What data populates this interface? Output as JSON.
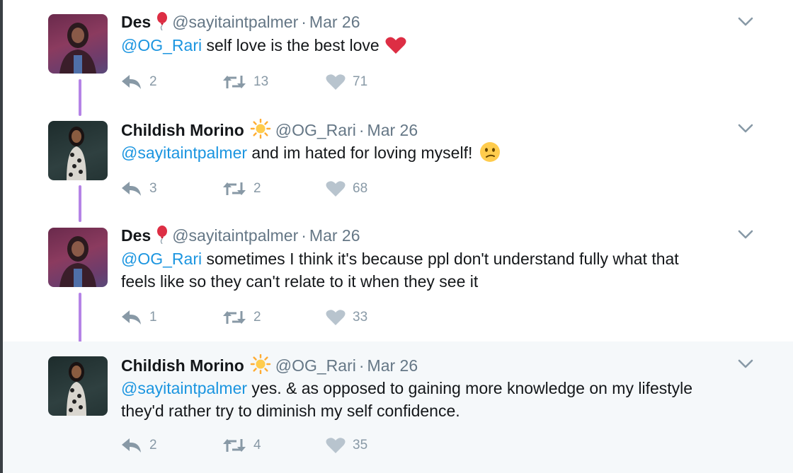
{
  "tweets": [
    {
      "name": "Des",
      "name_emoji": "balloon-icon",
      "handle": "@sayitaintpalmer",
      "separator": "·",
      "date": "Mar 26",
      "mention": "@OG_Rari",
      "line1": " self love is the best love",
      "line2": "",
      "trailing_emoji": "heart-emoji-icon",
      "replies": "2",
      "retweets": "13",
      "likes": "71"
    },
    {
      "name": "Childish Morino",
      "name_emoji": "sun-icon",
      "handle": "@OG_Rari",
      "separator": "·",
      "date": "Mar 26",
      "mention": "@sayitaintpalmer",
      "line1": " and im hated for loving myself!",
      "line2": "",
      "trailing_emoji": "confused-face-icon",
      "replies": "3",
      "retweets": "2",
      "likes": "68"
    },
    {
      "name": "Des",
      "name_emoji": "balloon-icon",
      "handle": "@sayitaintpalmer",
      "separator": "·",
      "date": "Mar 26",
      "mention": "@OG_Rari",
      "line1": " sometimes I think it's because ppl don't understand fully what that",
      "line2": "feels like so they can't relate to it when they see it",
      "trailing_emoji": "",
      "replies": "1",
      "retweets": "2",
      "likes": "33"
    },
    {
      "name": "Childish Morino",
      "name_emoji": "sun-icon",
      "handle": "@OG_Rari",
      "separator": "·",
      "date": "Mar 26",
      "mention": "@sayitaintpalmer",
      "line1": " yes. & as opposed to gaining more knowledge on my lifestyle",
      "line2": "they'd rather try to diminish my self confidence.",
      "trailing_emoji": "",
      "replies": "2",
      "retweets": "4",
      "likes": "35"
    }
  ],
  "colors": {
    "link": "#1b95e0",
    "secondary_text": "#657786",
    "action_icon": "#8899a6",
    "thread_line": "#b583e6",
    "highlight_bg": "#f5f8fa"
  }
}
